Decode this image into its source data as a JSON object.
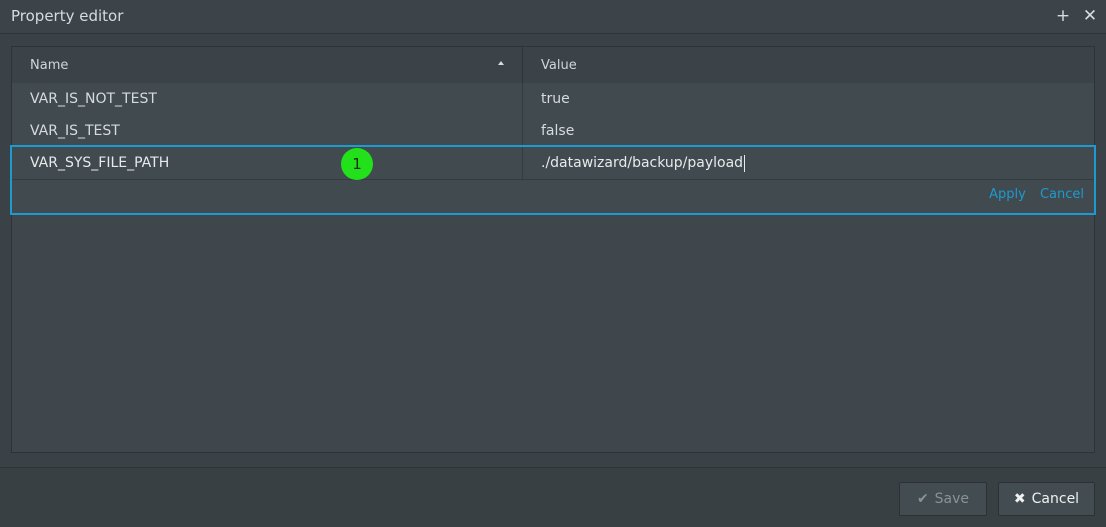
{
  "window": {
    "title": "Property editor",
    "add_glyph": "+",
    "close_glyph": "✕"
  },
  "table": {
    "columns": [
      {
        "label": "Name",
        "sort": "ascending"
      },
      {
        "label": "Value"
      }
    ],
    "rows": [
      {
        "name": "VAR_IS_NOT_TEST",
        "value": "true"
      },
      {
        "name": "VAR_IS_TEST",
        "value": "false"
      }
    ],
    "editing_row": {
      "name": "VAR_SYS_FILE_PATH",
      "value": "./datawizard/backup/payload",
      "apply_label": "Apply",
      "cancel_label": "Cancel"
    }
  },
  "step_badge": "1",
  "footer": {
    "save_label": "Save",
    "cancel_label": "Cancel",
    "save_icon": "check-icon",
    "cancel_icon": "x-icon"
  },
  "colors": {
    "accent": "#1d9bd1",
    "badge": "#22e11b",
    "background": "#3a4247"
  }
}
